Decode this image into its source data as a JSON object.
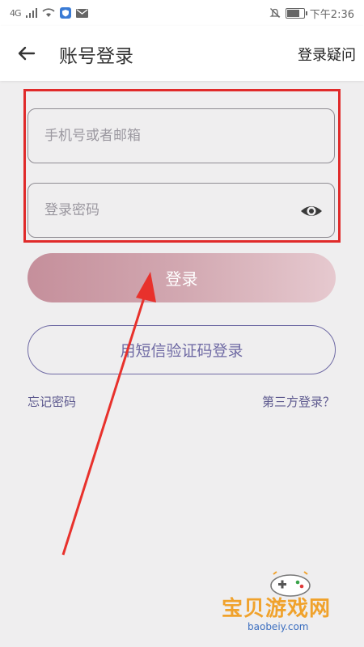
{
  "status": {
    "network": "4G",
    "time": "下午2:36"
  },
  "header": {
    "title": "账号登录",
    "help_link": "登录疑问"
  },
  "form": {
    "account_placeholder": "手机号或者邮箱",
    "password_placeholder": "登录密码"
  },
  "buttons": {
    "login": "登录",
    "sms_login": "用短信验证码登录"
  },
  "links": {
    "forgot": "忘记密码",
    "third_party": "第三方登录？"
  },
  "watermark": {
    "name": "宝贝游戏网",
    "url": "baobeiy.com"
  },
  "colors": {
    "annotation": "#e02a2a",
    "login_button_start": "#c58f9b",
    "login_button_end": "#e6c9cf",
    "accent": "#6f6aa4"
  },
  "icons": [
    "back-arrow-icon",
    "eye-icon",
    "signal-icon",
    "wifi-icon",
    "mute-icon",
    "battery-icon"
  ],
  "battery_level": 0.85
}
